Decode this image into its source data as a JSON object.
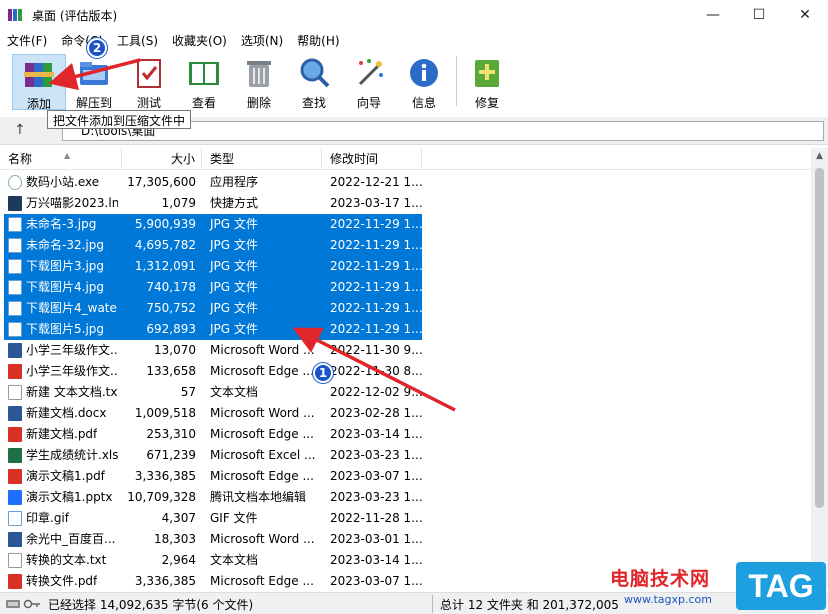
{
  "window": {
    "title": "桌面 (评估版本)"
  },
  "menu": [
    "文件(F)",
    "命令(C)",
    "工具(S)",
    "收藏夹(O)",
    "选项(N)",
    "帮助(H)"
  ],
  "toolbar": [
    {
      "id": "add",
      "label": "添加",
      "icon": "archive-books-icon"
    },
    {
      "id": "extract",
      "label": "解压到",
      "icon": "extract-folder-icon"
    },
    {
      "id": "test",
      "label": "测试",
      "icon": "clipboard-check-icon"
    },
    {
      "id": "view",
      "label": "查看",
      "icon": "open-book-icon"
    },
    {
      "id": "delete",
      "label": "删除",
      "icon": "trash-can-icon"
    },
    {
      "id": "find",
      "label": "查找",
      "icon": "magnifier-icon"
    },
    {
      "id": "wizard",
      "label": "向导",
      "icon": "magic-wand-icon"
    },
    {
      "id": "info",
      "label": "信息",
      "icon": "info-icon"
    },
    {
      "id": "repair",
      "label": "修复",
      "icon": "repair-kit-icon"
    }
  ],
  "tooltip": "把文件添加到压缩文件中",
  "address": "D:\\tools\\桌面",
  "columns": {
    "name": "名称",
    "size": "大小",
    "type": "类型",
    "modified": "修改时间"
  },
  "files": [
    {
      "name": "数码小站.exe",
      "size": "17,305,600",
      "type": "应用程序",
      "date": "2022-12-21 1...",
      "icon": "exe",
      "selected": false
    },
    {
      "name": "万兴喵影2023.lnk",
      "size": "1,079",
      "type": "快捷方式",
      "date": "2023-03-17 1...",
      "icon": "lnk",
      "selected": false
    },
    {
      "name": "未命名-3.jpg",
      "size": "5,900,939",
      "type": "JPG 文件",
      "date": "2022-11-29 1...",
      "icon": "jpg",
      "selected": true
    },
    {
      "name": "未命名-32.jpg",
      "size": "4,695,782",
      "type": "JPG 文件",
      "date": "2022-11-29 1...",
      "icon": "jpg",
      "selected": true
    },
    {
      "name": "下载图片3.jpg",
      "size": "1,312,091",
      "type": "JPG 文件",
      "date": "2022-11-29 1...",
      "icon": "jpg",
      "selected": true
    },
    {
      "name": "下载图片4.jpg",
      "size": "740,178",
      "type": "JPG 文件",
      "date": "2022-11-29 1...",
      "icon": "jpg",
      "selected": true
    },
    {
      "name": "下载图片4_wate...",
      "size": "750,752",
      "type": "JPG 文件",
      "date": "2022-11-29 1...",
      "icon": "jpg",
      "selected": true
    },
    {
      "name": "下载图片5.jpg",
      "size": "692,893",
      "type": "JPG 文件",
      "date": "2022-11-29 1...",
      "icon": "jpg",
      "selected": true
    },
    {
      "name": "小学三年级作文...",
      "size": "13,070",
      "type": "Microsoft Word ...",
      "date": "2022-11-30 9...",
      "icon": "word",
      "selected": false
    },
    {
      "name": "小学三年级作文...",
      "size": "133,658",
      "type": "Microsoft Edge ...",
      "date": "2022-11-30 8...",
      "icon": "pdf",
      "selected": false
    },
    {
      "name": "新建 文本文档.txt",
      "size": "57",
      "type": "文本文档",
      "date": "2022-12-02 9...",
      "icon": "txt",
      "selected": false
    },
    {
      "name": "新建文档.docx",
      "size": "1,009,518",
      "type": "Microsoft Word ...",
      "date": "2023-02-28 1...",
      "icon": "word",
      "selected": false
    },
    {
      "name": "新建文档.pdf",
      "size": "253,310",
      "type": "Microsoft Edge ...",
      "date": "2023-03-14 1...",
      "icon": "pdf",
      "selected": false
    },
    {
      "name": "学生成绩统计.xlsx",
      "size": "671,239",
      "type": "Microsoft Excel ...",
      "date": "2023-03-23 1...",
      "icon": "excel",
      "selected": false
    },
    {
      "name": "演示文稿1.pdf",
      "size": "3,336,385",
      "type": "Microsoft Edge ...",
      "date": "2023-03-07 1...",
      "icon": "pdf",
      "selected": false
    },
    {
      "name": "演示文稿1.pptx",
      "size": "10,709,328",
      "type": "腾讯文档本地编辑",
      "date": "2023-03-23 1...",
      "icon": "tdoc",
      "selected": false
    },
    {
      "name": "印章.gif",
      "size": "4,307",
      "type": "GIF 文件",
      "date": "2022-11-28 1...",
      "icon": "gif",
      "selected": false
    },
    {
      "name": "余光中_百度百...",
      "size": "18,303",
      "type": "Microsoft Word ...",
      "date": "2023-03-01 1...",
      "icon": "word",
      "selected": false
    },
    {
      "name": "转换的文本.txt",
      "size": "2,964",
      "type": "文本文档",
      "date": "2023-03-14 1...",
      "icon": "txt",
      "selected": false
    },
    {
      "name": "转换文件.pdf",
      "size": "3,336,385",
      "type": "Microsoft Edge ...",
      "date": "2023-03-07 1...",
      "icon": "pdf",
      "selected": false
    }
  ],
  "status": {
    "left": "已经选择 14,092,635 字节(6 个文件)",
    "right": "总计 12 文件夹 和 201,372,005"
  },
  "annotations": {
    "badge1": "1",
    "badge2": "2"
  },
  "watermark": {
    "title": "电脑技术网",
    "url": "www.tagxp.com",
    "tag": "TAG"
  },
  "colors": {
    "selection": "#0078d7",
    "arrow": "#e0262a",
    "badge": "#1a56c8"
  }
}
